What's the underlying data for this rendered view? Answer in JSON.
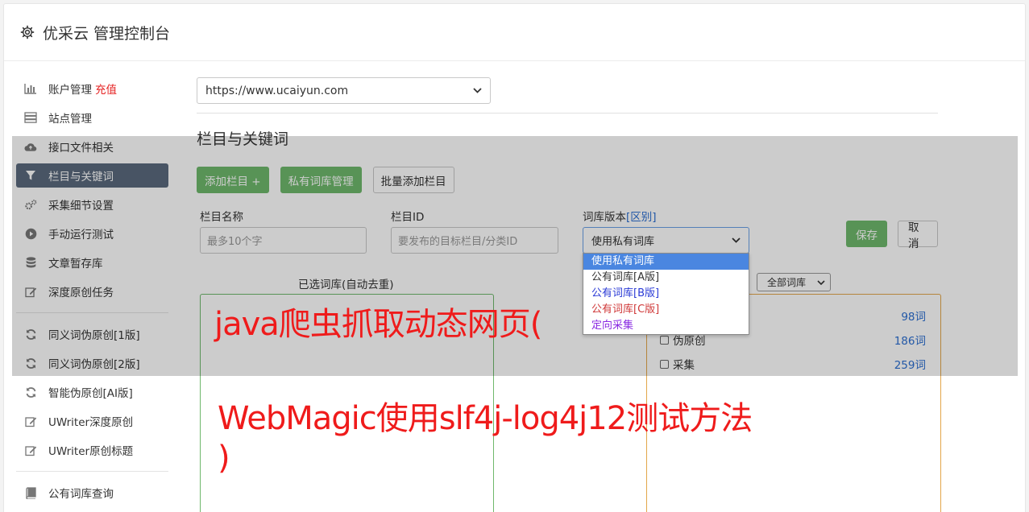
{
  "header": {
    "title": "优采云 管理控制台"
  },
  "sidebar": {
    "group1": [
      {
        "label": "账户管理",
        "badge": "充值",
        "icon": "bar-chart-icon"
      },
      {
        "label": "站点管理",
        "icon": "server-icon"
      },
      {
        "label": "接口文件相关",
        "icon": "cloud-upload-icon"
      },
      {
        "label": "栏目与关键词",
        "icon": "filter-icon",
        "active": true
      },
      {
        "label": "采集细节设置",
        "icon": "gears-icon"
      },
      {
        "label": "手动运行测试",
        "icon": "play-circle-icon"
      },
      {
        "label": "文章暂存库",
        "icon": "database-icon"
      },
      {
        "label": "深度原创任务",
        "icon": "edit-icon"
      }
    ],
    "group2": [
      {
        "label": "同义词伪原创[1版]",
        "icon": "refresh-icon"
      },
      {
        "label": "同义词伪原创[2版]",
        "icon": "refresh-icon"
      },
      {
        "label": "智能伪原创[AI版]",
        "icon": "refresh-icon"
      },
      {
        "label": "UWriter深度原创",
        "icon": "edit-icon"
      },
      {
        "label": "UWriter原创标题",
        "icon": "edit-icon"
      }
    ],
    "group3": [
      {
        "label": "公有词库查询",
        "icon": "book-icon"
      }
    ]
  },
  "main": {
    "site_select": "https://www.ucaiyun.com",
    "section_title": "栏目与关键词",
    "buttons": {
      "add_column": "添加栏目 +",
      "private_lib": "私有词库管理",
      "batch_add": "批量添加栏目"
    },
    "form": {
      "name_label": "栏目名称",
      "name_placeholder": "最多10个字",
      "id_label": "栏目ID",
      "id_placeholder": "要发布的目标栏目/分类ID",
      "version_label": "词库版本",
      "version_hint": "[区别]",
      "version_value": "使用私有词库",
      "save": "保存",
      "cancel": "取消"
    },
    "left_caption": "已选词库(自动去重)",
    "lib_select": "全部词库",
    "libraries": [
      {
        "name": "",
        "count": "98词"
      },
      {
        "name": "伪原创",
        "count": "186词"
      },
      {
        "name": "采集",
        "count": "259词"
      }
    ],
    "dropdown": [
      {
        "label": "使用私有词库",
        "color": "#ffffff",
        "selected": true
      },
      {
        "label": "公有词库[A版]",
        "color": "#333333"
      },
      {
        "label": "公有词库[B版]",
        "color": "#2b3bd6"
      },
      {
        "label": "公有词库[C版]",
        "color": "#d03a3a"
      },
      {
        "label": "定向采集",
        "color": "#8a2be2"
      }
    ]
  },
  "watermark": {
    "line1": "java爬虫抓取动态网页(",
    "line2": "WebMagic使用slf4j-log4j12测试方法",
    "line3": ")"
  }
}
